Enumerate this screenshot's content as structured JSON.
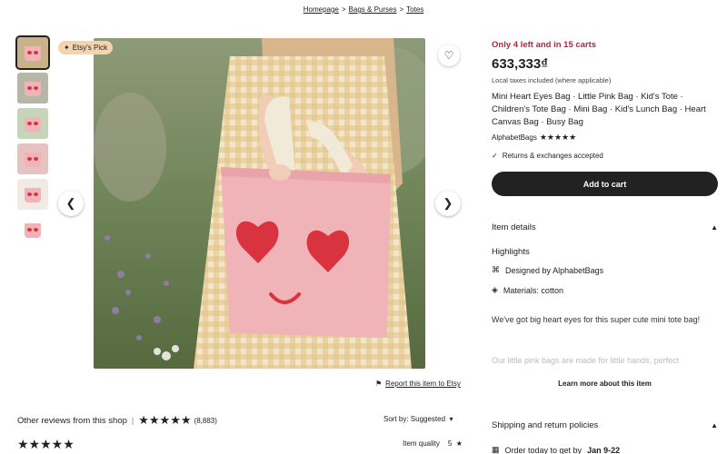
{
  "breadcrumb": [
    "Homepage",
    "Bags & Purses",
    "Totes"
  ],
  "badge": {
    "label": "Etsy's Pick"
  },
  "report": {
    "label": "Report this item to Etsy"
  },
  "reviews": {
    "title": "Other reviews from this shop",
    "rating": "★★★★★",
    "count": "(8,883)",
    "sort_label": "Sort by: Suggested",
    "review_stars": "★★★★★",
    "item_quality_label": "Item quality",
    "item_quality_value": "5"
  },
  "product": {
    "stock": "Only 4 left and in 15 carts",
    "price": "633,333₫",
    "taxes": "Local taxes included (where applicable)",
    "title": "Mini Heart Eyes Bag · Little Pink Bag · Kid's Tote · Children's Tote Bag · Mini Bag · Kid's Lunch Bag · Heart Canvas Bag · Busy Bag",
    "shop": "AlphabetBags",
    "shop_rating": "★★★★★",
    "returns": "Returns & exchanges accepted",
    "add_to_cart": "Add to cart"
  },
  "details": {
    "heading": "Item details",
    "highlights": "Highlights",
    "designed_by_prefix": "Designed by",
    "designed_by": "AlphabetBags",
    "materials": "Materials: cotton",
    "description": "We've got big heart eyes for this super cute mini tote bag!",
    "description_faded": "Our little pink bags are made for little hands, perfect",
    "learn_more": "Learn more about this item"
  },
  "shipping": {
    "heading": "Shipping and return policies",
    "order_prefix": "Order today to get by",
    "order_date": "Jan 9-22"
  },
  "colors": {
    "bag_pink": "#f0b3b8",
    "heart_red": "#d9333f",
    "stock_red": "#b3263d",
    "button_dark": "#222222",
    "badge_bg": "#f5d3ae"
  }
}
